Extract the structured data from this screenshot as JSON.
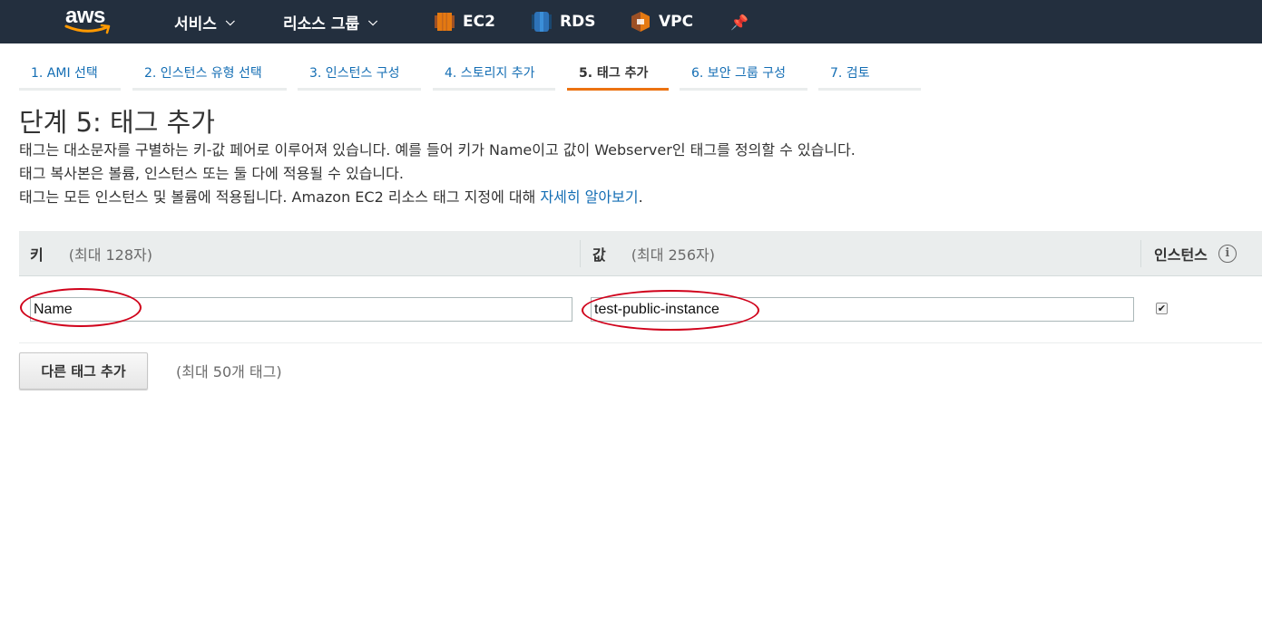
{
  "topnav": {
    "logo": "aws",
    "services": "서비스",
    "resource_groups": "리소스 그룹",
    "shortcuts": [
      {
        "label": "EC2",
        "icon": "ec2-icon",
        "color": "#e47911"
      },
      {
        "label": "RDS",
        "icon": "rds-icon",
        "color": "#2e73b8"
      },
      {
        "label": "VPC",
        "icon": "vpc-icon",
        "color": "#e47911"
      }
    ],
    "pin_icon": "pin-icon",
    "background": "#232f3e"
  },
  "wizard": {
    "steps": [
      {
        "label": "1. AMI 선택"
      },
      {
        "label": "2. 인스턴스 유형 선택"
      },
      {
        "label": "3. 인스턴스 구성"
      },
      {
        "label": "4. 스토리지 추가"
      },
      {
        "label": "5. 태그 추가",
        "active": true
      },
      {
        "label": "6. 보안 그룹 구성"
      },
      {
        "label": "7. 검토"
      }
    ],
    "active_color": "#ec7211"
  },
  "page": {
    "title": "단계 5: 태그 추가",
    "desc1": "태그는 대소문자를 구별하는 키-값 페어로 이루어져 있습니다. 예를 들어 키가 Name이고 값이 Webserver인 태그를 정의할 수 있습니다.",
    "desc2": "태그 복사본은 볼륨, 인스턴스 또는 둘 다에 적용될 수 있습니다.",
    "desc3": "태그는 모든 인스턴스 및 볼륨에 적용됩니다. Amazon EC2 리소스 태그 지정에 대해",
    "learn_more": "자세히 알아보기",
    "period": "."
  },
  "table": {
    "key_header": "키",
    "key_hint": "(최대 128자)",
    "value_header": "값",
    "value_hint": "(최대 256자)",
    "instances_header": "인스턴스",
    "rows": [
      {
        "key": "Name",
        "value": "test-public-instance",
        "instances_checked": true
      }
    ]
  },
  "actions": {
    "add_tag": "다른 태그 추가",
    "limit_note": "(최대 50개 태그)"
  },
  "annotation_color": "#d0021b",
  "link_color": "#146eb4"
}
